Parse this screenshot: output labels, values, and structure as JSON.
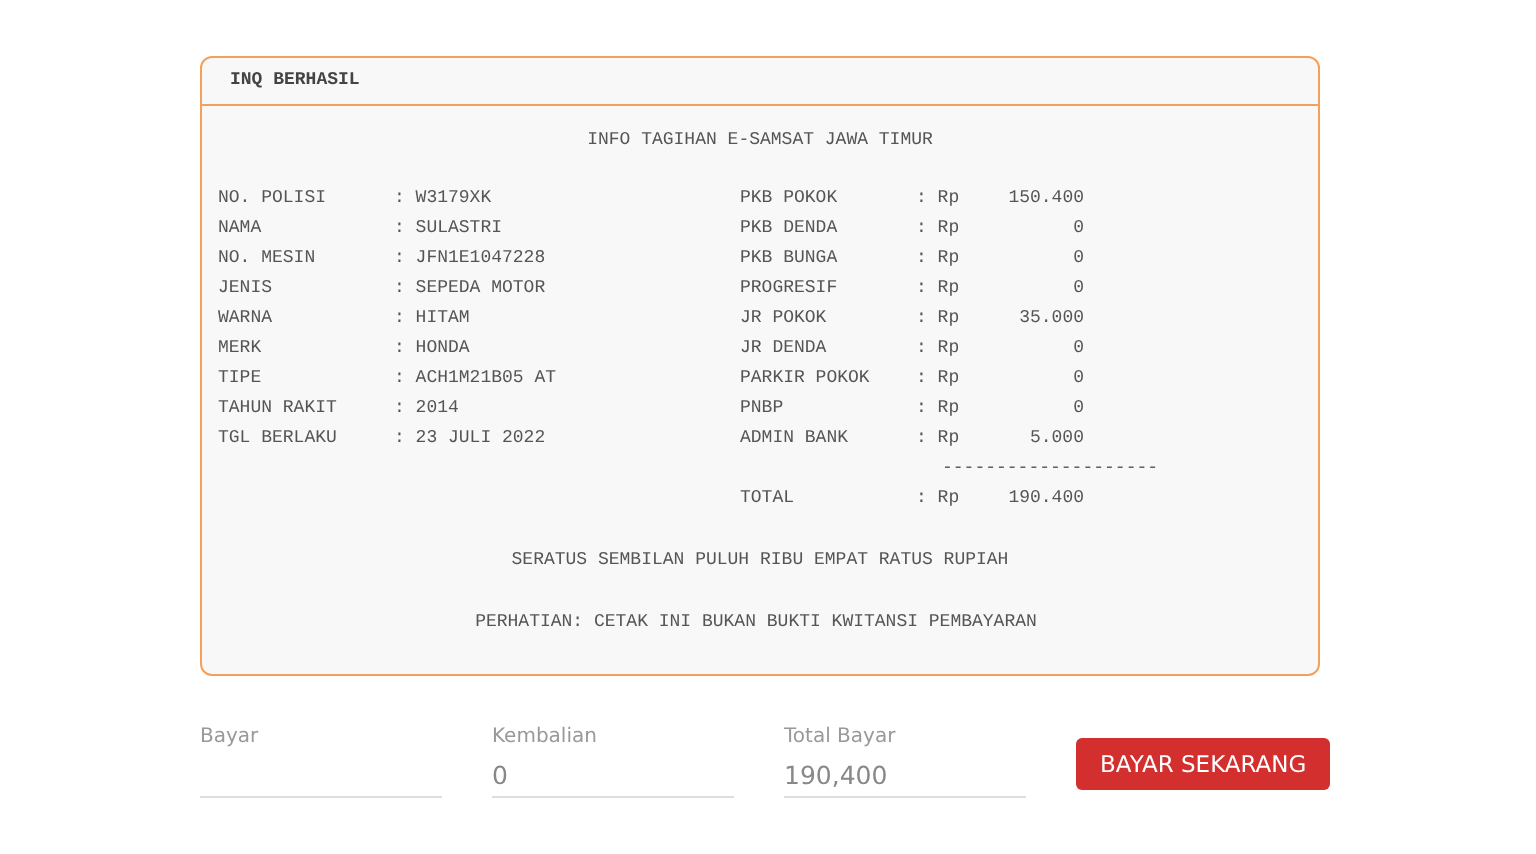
{
  "receipt": {
    "header": "INQ BERHASIL",
    "title": "INFO TAGIHAN E-SAMSAT JAWA TIMUR",
    "vehicle": [
      {
        "label": "NO. POLISI",
        "value": ": W3179XK"
      },
      {
        "label": "NAMA",
        "value": ": SULASTRI"
      },
      {
        "label": "NO. MESIN",
        "value": ": JFN1E1047228"
      },
      {
        "label": "JENIS",
        "value": ": SEPEDA MOTOR"
      },
      {
        "label": "WARNA",
        "value": ": HITAM"
      },
      {
        "label": "MERK",
        "value": ": HONDA"
      },
      {
        "label": "TIPE",
        "value": ": ACH1M21B05 AT"
      },
      {
        "label": "TAHUN RAKIT",
        "value": ": 2014"
      },
      {
        "label": "TGL BERLAKU",
        "value": ": 23 JULI 2022"
      }
    ],
    "charges": [
      {
        "label": "PKB POKOK",
        "currency": ": Rp",
        "amount": "150.400"
      },
      {
        "label": "PKB DENDA",
        "currency": ": Rp",
        "amount": "0"
      },
      {
        "label": "PKB BUNGA",
        "currency": ": Rp",
        "amount": "0"
      },
      {
        "label": "PROGRESIF",
        "currency": ": Rp",
        "amount": "0"
      },
      {
        "label": "JR POKOK",
        "currency": ": Rp",
        "amount": "35.000"
      },
      {
        "label": "JR DENDA",
        "currency": ": Rp",
        "amount": "0"
      },
      {
        "label": "PARKIR POKOK",
        "currency": ": Rp",
        "amount": "0"
      },
      {
        "label": "PNBP",
        "currency": ": Rp",
        "amount": "0"
      },
      {
        "label": "ADMIN BANK",
        "currency": ": Rp",
        "amount": "5.000"
      }
    ],
    "separator": "--------------------",
    "total": {
      "label": "TOTAL",
      "currency": ": Rp",
      "amount": "190.400"
    },
    "amount_in_words": "SERATUS SEMBILAN PULUH RIBU EMPAT RATUS RUPIAH",
    "notice": "PERHATIAN: CETAK INI BUKAN BUKTI KWITANSI PEMBAYARAN"
  },
  "inputs": [
    {
      "label": "Bayar"
    },
    {
      "label": "Kembalian",
      "value": "0"
    },
    {
      "label": "Total Bayar",
      "value": "190,400"
    }
  ],
  "button": "BAYAR SEKARANG"
}
